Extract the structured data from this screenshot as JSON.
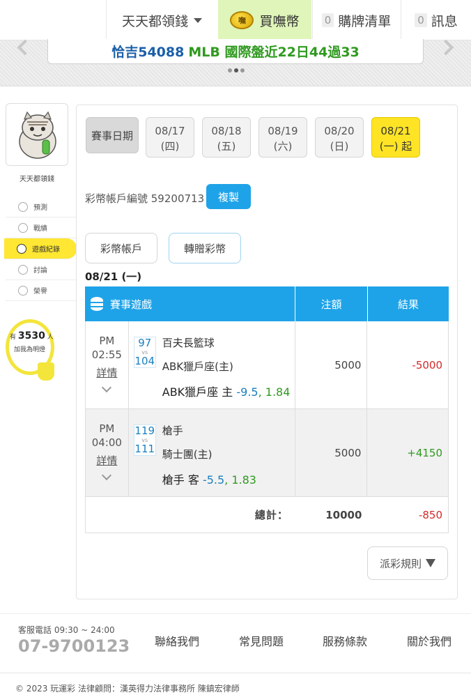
{
  "topbar": {
    "user_label": "天天都領錢",
    "buy_label": "買嘸幣",
    "coin_icon_text": "嘸",
    "cart_count": "0",
    "cart_label": "購牌清單",
    "msg_count": "0",
    "msg_label": "訊息"
  },
  "banner": {
    "text_a": "恰吉54088",
    "text_b": "MLB 國際盤近22日44過33"
  },
  "sidebar": {
    "name": "天天都領錢",
    "items": [
      {
        "label": "預測",
        "icon": "target-icon"
      },
      {
        "label": "戰績",
        "icon": "chart-icon"
      },
      {
        "label": "遊戲紀錄",
        "icon": "record-icon"
      },
      {
        "label": "討論",
        "icon": "chat-icon"
      },
      {
        "label": "榮譽",
        "icon": "trophy-icon"
      }
    ],
    "bulb": {
      "prefix": "有",
      "count": "3530",
      "suffix": "人",
      "caption": "加我為明燈"
    }
  },
  "main": {
    "date_label": "賽事日期",
    "dates": [
      {
        "date": "08/17",
        "day": "(四)"
      },
      {
        "date": "08/18",
        "day": "(五)"
      },
      {
        "date": "08/19",
        "day": "(六)"
      },
      {
        "date": "08/20",
        "day": "(日)"
      },
      {
        "date": "08/21",
        "day": "(一) 起"
      }
    ],
    "account_text": "彩幣帳戶編號 59200713",
    "copy_label": "複製",
    "tabs": [
      "彩幣帳戶",
      "轉贈彩幣"
    ],
    "day_title": "08/21 (一)",
    "table": {
      "headers": [
        "賽事遊戲",
        "注額",
        "結果"
      ],
      "rows": [
        {
          "ampm": "PM",
          "time": "02:55",
          "detail": "詳情",
          "score_top": "97",
          "vs": "vs",
          "score_bottom": "104",
          "team1": "百夫長籃球",
          "team2": "ABK獵戶座(主)",
          "bet_team": "ABK獵戶座 主",
          "bet_hcp": "-9.5",
          "bet_odd": "1.84",
          "amount": "5000",
          "result": "-5000"
        },
        {
          "ampm": "PM",
          "time": "04:00",
          "detail": "詳情",
          "score_top": "119",
          "vs": "vs",
          "score_bottom": "111",
          "team1": "槍手",
          "team2": "騎士團(主)",
          "bet_team": "槍手 客",
          "bet_hcp": "-5.5",
          "bet_odd": "1.83",
          "amount": "5000",
          "result": "+4150"
        }
      ],
      "total_label": "總計：",
      "total_amount": "10000",
      "total_result": "-850"
    },
    "rules_label": "派彩規則"
  },
  "footer": {
    "cs_label": "客服電話 09:30 ~ 24:00",
    "cs_phone": "07-9700123",
    "links": [
      "聯絡我們",
      "常見問題",
      "服務條款",
      "關於我們"
    ],
    "copyright": "© 2023 玩運彩 法律顧問：漢英得力法律事務所 陳鎮宏律師"
  }
}
